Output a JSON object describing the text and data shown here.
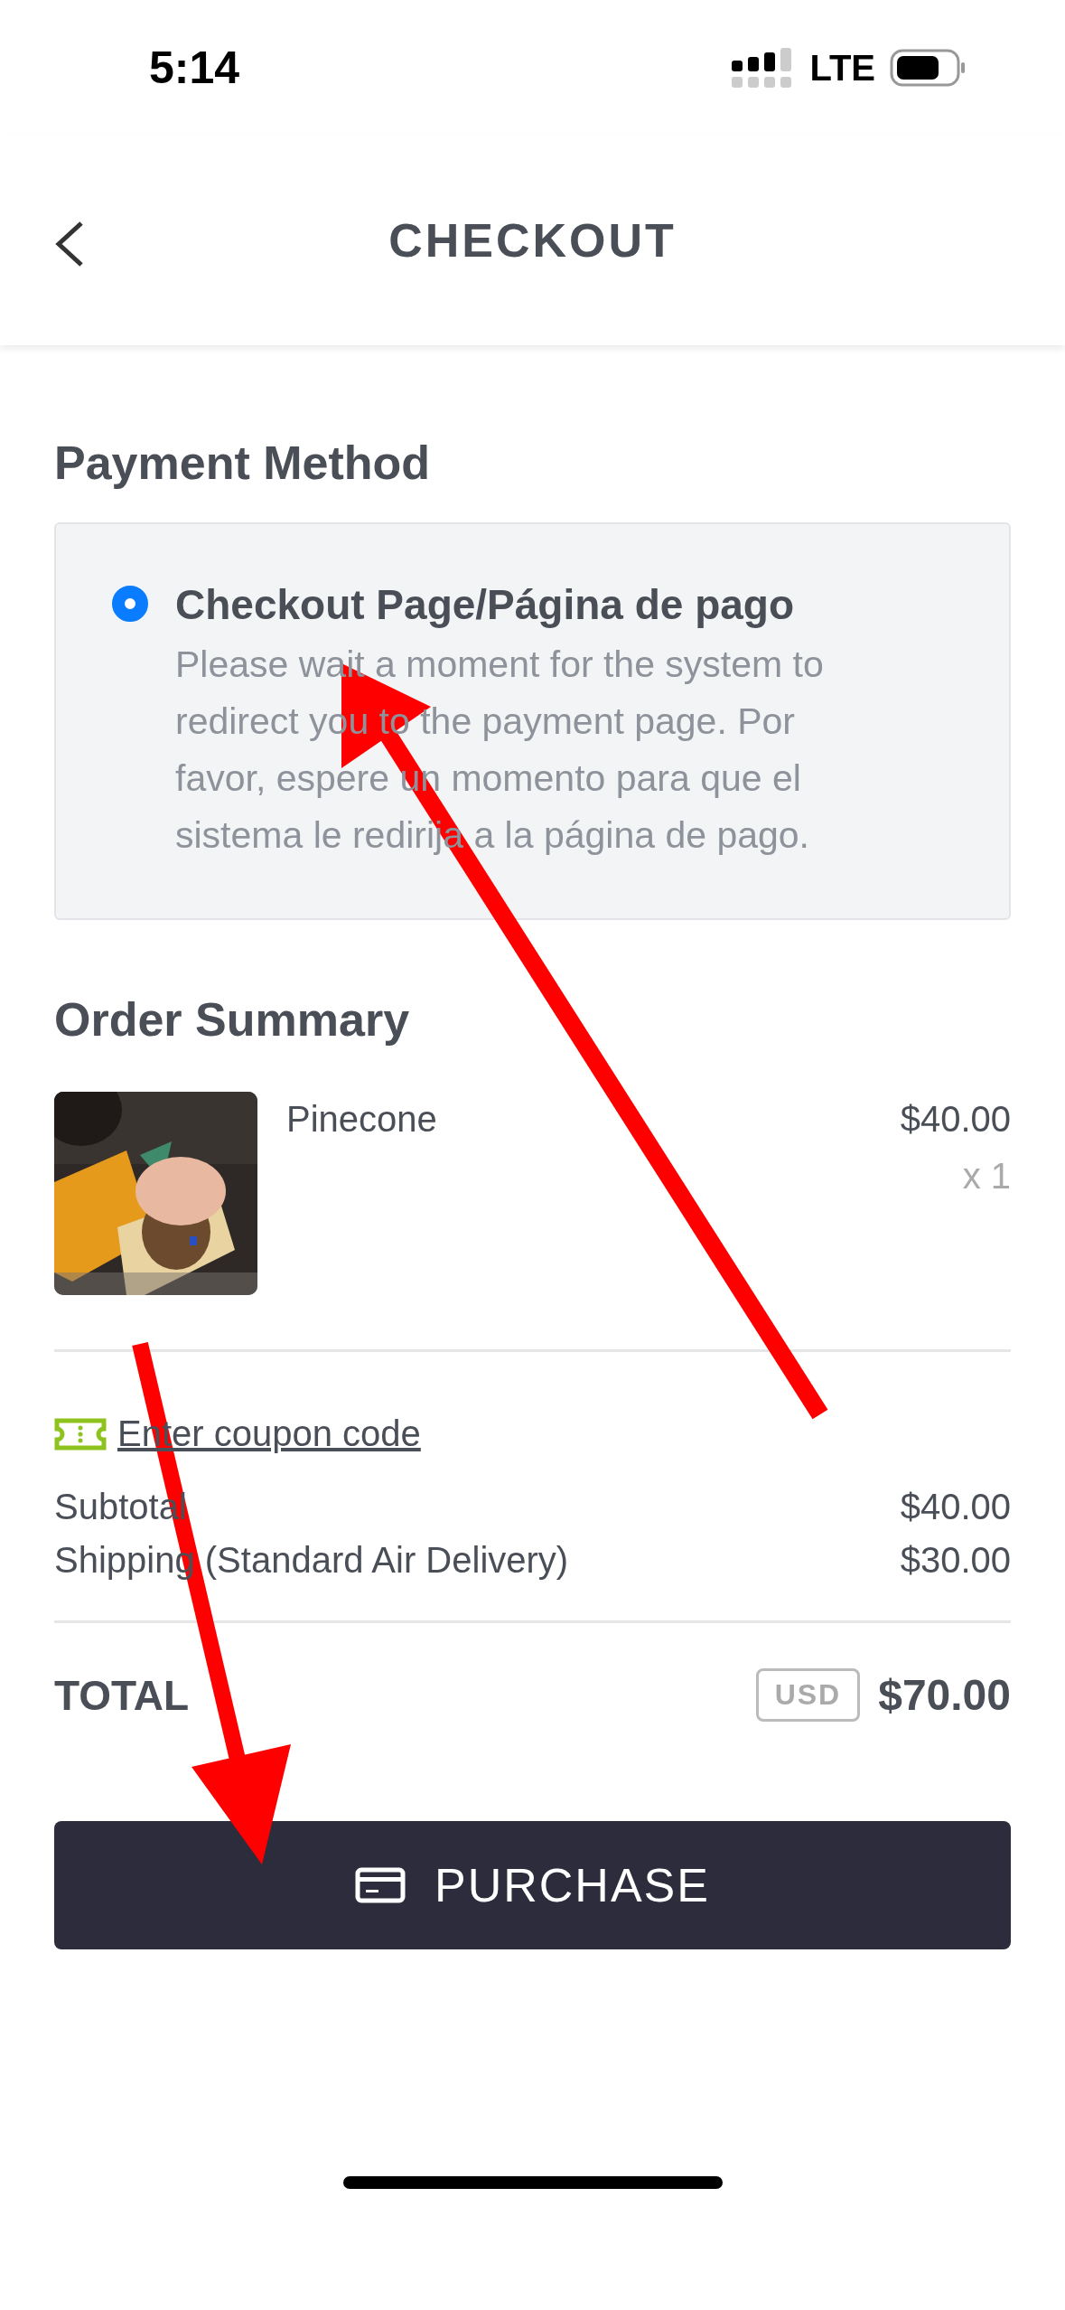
{
  "status_bar": {
    "time": "5:14",
    "network": "LTE"
  },
  "header": {
    "title": "CHECKOUT"
  },
  "payment": {
    "heading": "Payment Method",
    "options": [
      {
        "title": "Checkout Page/Página de pago",
        "description": "Please wait a moment for the system to redirect you to the payment page. Por favor, espere un momento para que el sistema le redirija a la página de pago.",
        "selected": true
      }
    ]
  },
  "order": {
    "heading": "Order Summary",
    "items": [
      {
        "kind": "picture",
        "name": "Pinecone",
        "price": "$40.00",
        "quantity": "x 1"
      }
    ]
  },
  "coupon": {
    "link": "Enter coupon code"
  },
  "lines": [
    {
      "label": "Subtotal",
      "amount": "$40.00"
    },
    {
      "label": "Shipping (Standard Air Delivery)",
      "amount": "$30.00"
    }
  ],
  "total": {
    "label": "TOTAL",
    "currency": "USD",
    "amount": "$70.00"
  },
  "button": {
    "label": "PURCHASE"
  }
}
